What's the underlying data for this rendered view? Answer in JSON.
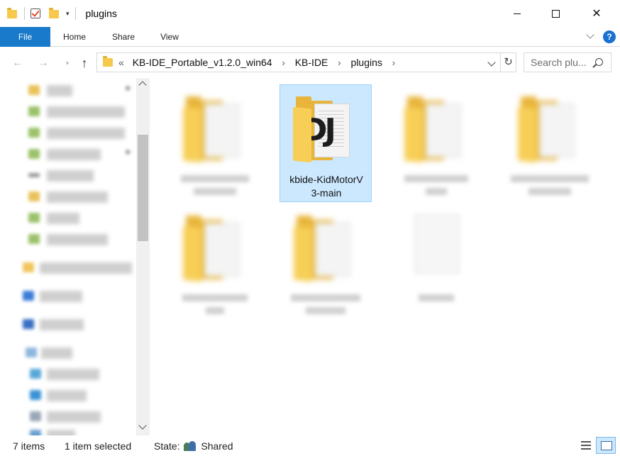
{
  "window": {
    "title": "plugins",
    "minimize_icon": "minimize-icon",
    "maximize_icon": "maximize-icon",
    "close_icon": "close-icon",
    "close_glyph": "✕"
  },
  "quick_access": {
    "dropdown_glyph": "▾"
  },
  "ribbon": {
    "tabs": [
      "File",
      "Home",
      "Share",
      "View"
    ],
    "file_tab_color": "#1979ca",
    "help_glyph": "?"
  },
  "address": {
    "overflow_glyph": "«",
    "crumbs": [
      "KB-IDE_Portable_v1.2.0_win64",
      "KB-IDE",
      "plugins"
    ],
    "chevron_glyph": "›",
    "refresh_glyph": "↻"
  },
  "nav_buttons": {
    "back_glyph": "←",
    "forward_glyph": "→",
    "recent_glyph": "▾",
    "up_glyph": "↑"
  },
  "search": {
    "placeholder": "Search plu..."
  },
  "content": {
    "selected_item": {
      "name": "kbide-KidMotorV3-main",
      "line1": "kbide-KidMotorV",
      "line2": "3-main",
      "icon_letters": "DJ"
    }
  },
  "status": {
    "items_count": "7 items",
    "selected": "1 item selected",
    "state_label": "State:",
    "state_value": "Shared"
  },
  "colors": {
    "selection_bg": "#cce8ff",
    "selection_border": "#99d1ff",
    "folder_yellow": "#f7cf57",
    "accent": "#1979ca"
  }
}
